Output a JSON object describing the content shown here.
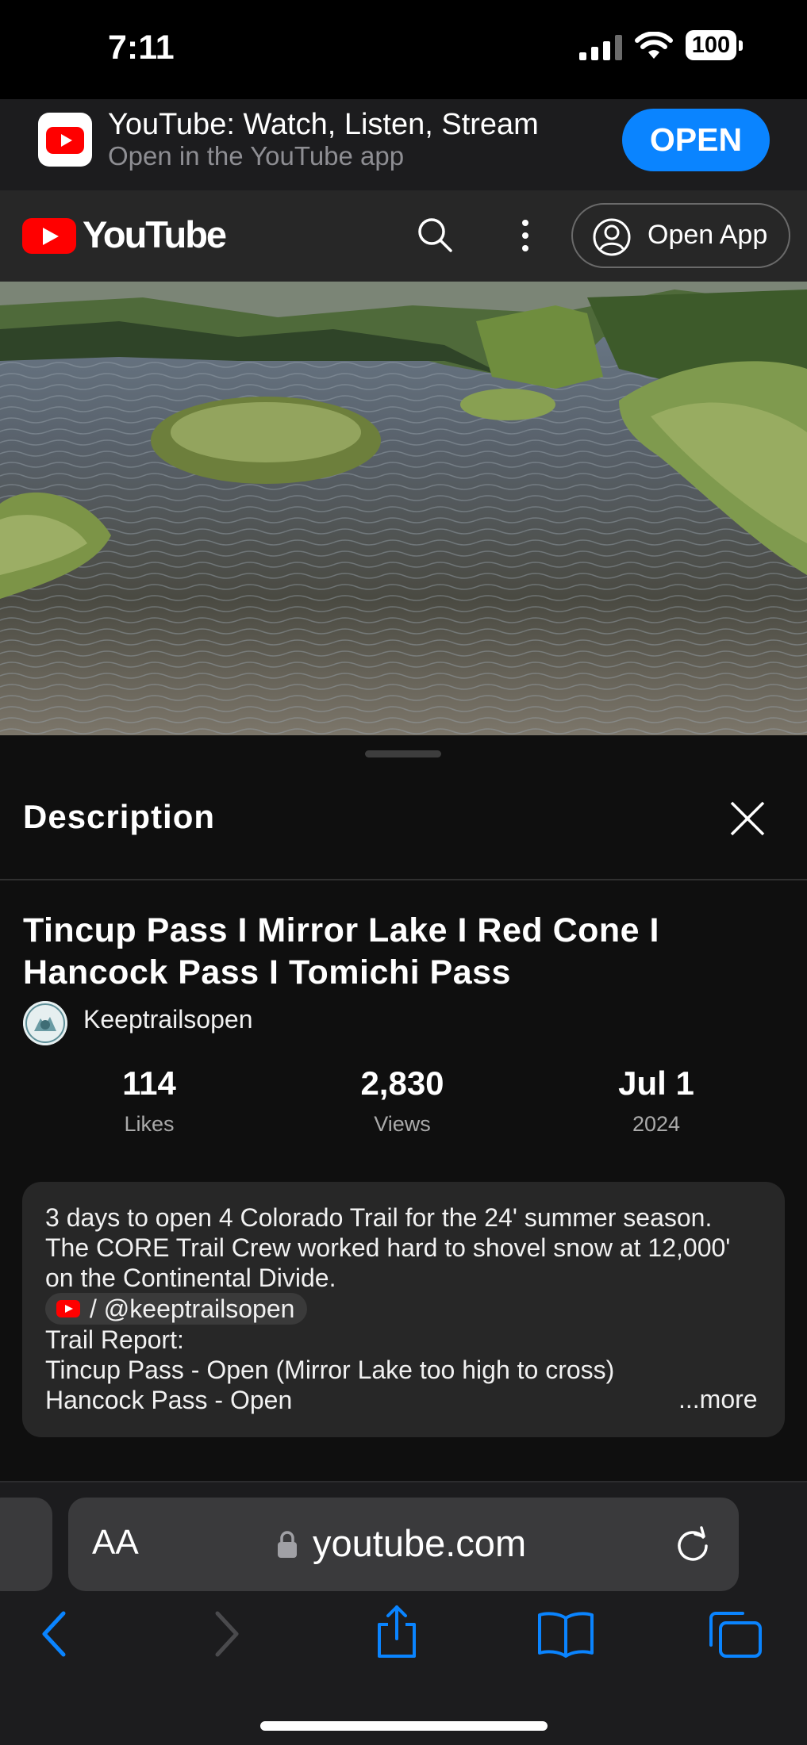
{
  "status_bar": {
    "time": "7:11",
    "battery": "100"
  },
  "app_banner": {
    "title": "YouTube: Watch, Listen, Stream",
    "subtitle": "Open in the YouTube app",
    "open_label": "OPEN"
  },
  "yt_header": {
    "logo_text": "YouTube",
    "open_app_label": "Open App"
  },
  "panel": {
    "heading": "Description",
    "video_title": "Tincup Pass I Mirror Lake I Red Cone I Hancock Pass I Tomichi Pass",
    "channel": "Keeptrailsopen",
    "stats": [
      {
        "value": "114",
        "label": "Likes"
      },
      {
        "value": "2,830",
        "label": "Views"
      },
      {
        "value": "Jul 1",
        "label": "2024"
      }
    ],
    "description": {
      "line1": "3 days to open 4 Colorado Trail for the 24' summer season.",
      "line2": "The CORE Trail Crew worked hard to shovel snow at 12,000'",
      "line3": "on the Continental Divide.",
      "handle": "/ @keeptrailsopen",
      "line5": "Trail Report:",
      "line6": "Tincup Pass - Open (Mirror Lake too high to cross)",
      "line7": "Hancock Pass - Open",
      "more": "...more"
    }
  },
  "safari": {
    "aa": "AA",
    "url": "youtube.com"
  },
  "colors": {
    "accent": "#0a84ff",
    "youtube_red": "#ff0000",
    "background": "#0f0f0f"
  },
  "icons": [
    "youtube-logo-icon",
    "search-icon",
    "more-vert-icon",
    "account-icon",
    "close-icon",
    "lock-icon",
    "reload-icon",
    "back-icon",
    "forward-icon",
    "share-icon",
    "bookmarks-icon",
    "tabs-icon"
  ]
}
